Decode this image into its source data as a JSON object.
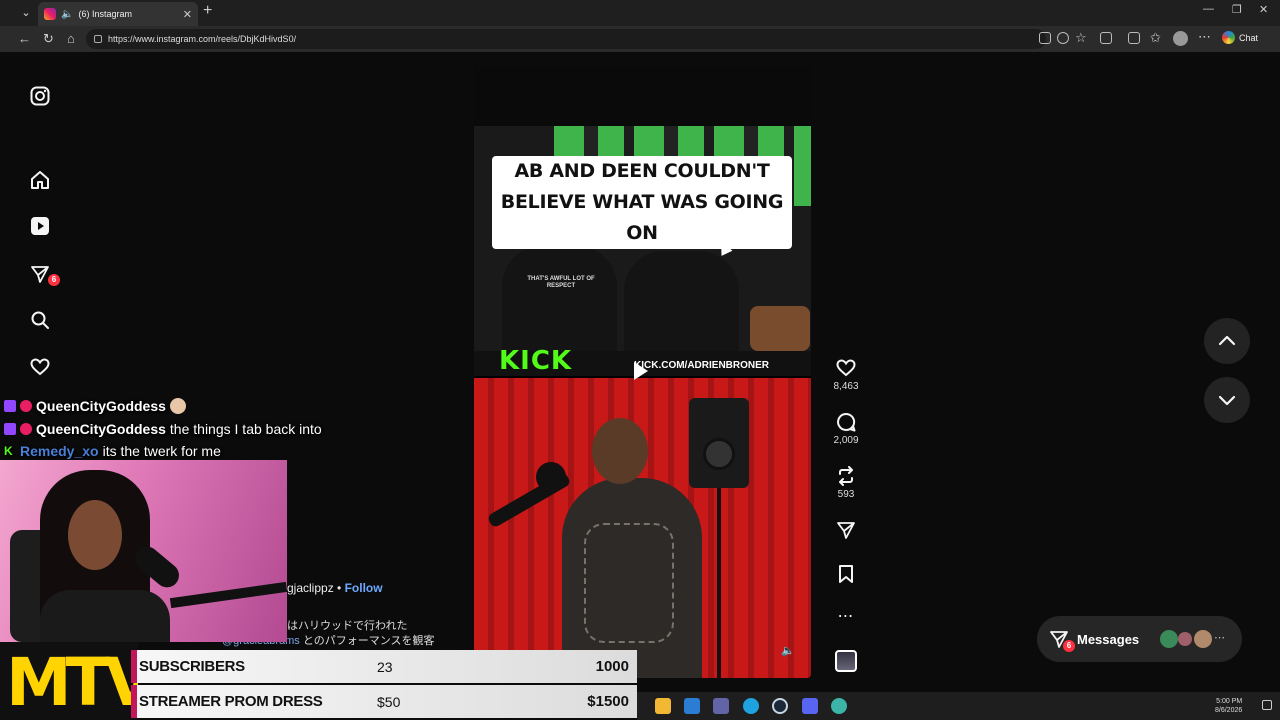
{
  "browser": {
    "tab_title": "(6) Instagram",
    "url": "https://www.instagram.com/reels/DbjKdHivdS0/",
    "chat_label": "Chat"
  },
  "ig_nav": {
    "notifications_badge": "6"
  },
  "reel": {
    "caption_line1": "AB AND DEEN COULDN'T",
    "caption_line2": "BELIEVE WHAT WAS GOING ON",
    "shirt_text": "THAT'S AWFUL LOT OF RESPECT",
    "kick_logo": "KICK",
    "kick_url": "KICK.COM/ADRIENBRONER",
    "likes": "8,463",
    "comments": "2,009",
    "reposts": "593",
    "post_user": "gjaclippz",
    "follow_label": "Follow",
    "jp_line1": "はハリウッドで行われた",
    "jp_tag": "@gracieabrams",
    "jp_line2": "とのパフォーマンスを観客"
  },
  "messages": {
    "label": "Messages",
    "badge": "6"
  },
  "chat": [
    {
      "user": "QueenCityGoddess",
      "message": "",
      "user_color": "#ffffff",
      "platform": "twitch"
    },
    {
      "user": "QueenCityGoddess",
      "message": "the things I tab back into",
      "user_color": "#ffffff",
      "platform": "twitch"
    },
    {
      "user": "Remedy_xo",
      "message": "its the twerk for me",
      "user_color": "#4a7fd6",
      "platform": "kick"
    }
  ],
  "goals": [
    {
      "name": "SUBSCRIBERS",
      "current": "23",
      "target": "1000"
    },
    {
      "name": "STREAMER PROM DRESS",
      "current": "$50",
      "target": "$1500"
    }
  ],
  "overlay_logo": "MTV",
  "taskbar": {
    "time": "5:00 PM",
    "date": "8/6/2026"
  },
  "colors": {
    "instagram_red": "#ff3040",
    "kick_green": "#53fc18",
    "goal_accent": "#c2185b",
    "mtv_yellow": "#ffd400"
  }
}
